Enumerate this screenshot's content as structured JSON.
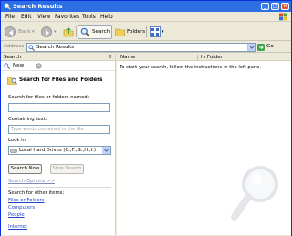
{
  "window": {
    "title": "Search Results"
  },
  "menu": [
    "File",
    "Edit",
    "View",
    "Favorites",
    "Tools",
    "Help"
  ],
  "toolbar": {
    "back_label": "Back",
    "search_label": "Search",
    "folders_label": "Folders"
  },
  "address": {
    "label": "Address",
    "value": "Search Results",
    "go_label": "Go"
  },
  "search_pane": {
    "title": "Search",
    "new_label": "New",
    "heading": "Search for Files and Folders",
    "name_label": "Search for files or folders named:",
    "name_value": "",
    "containing_label": "Containing text:",
    "containing_placeholder": "Type words contained in the file.",
    "look_in_label": "Look in:",
    "look_in_value": "Local Hard Drives (C:,F:,G:,H:,I:)",
    "search_now": "Search Now",
    "stop_search": "Stop Search",
    "options_link": "Search Options >>",
    "other_label": "Search for other items:",
    "other_items": [
      "Files or Folders",
      "Computers",
      "People"
    ],
    "internet_link": "Internet"
  },
  "results": {
    "columns": [
      "Name",
      "In Folder"
    ],
    "hint": "To start your search, follow the instructions in the left pane."
  },
  "colors": {
    "title_bar": "#2f6fe4",
    "link": "#2145c8",
    "chrome": "#ece9d8"
  }
}
